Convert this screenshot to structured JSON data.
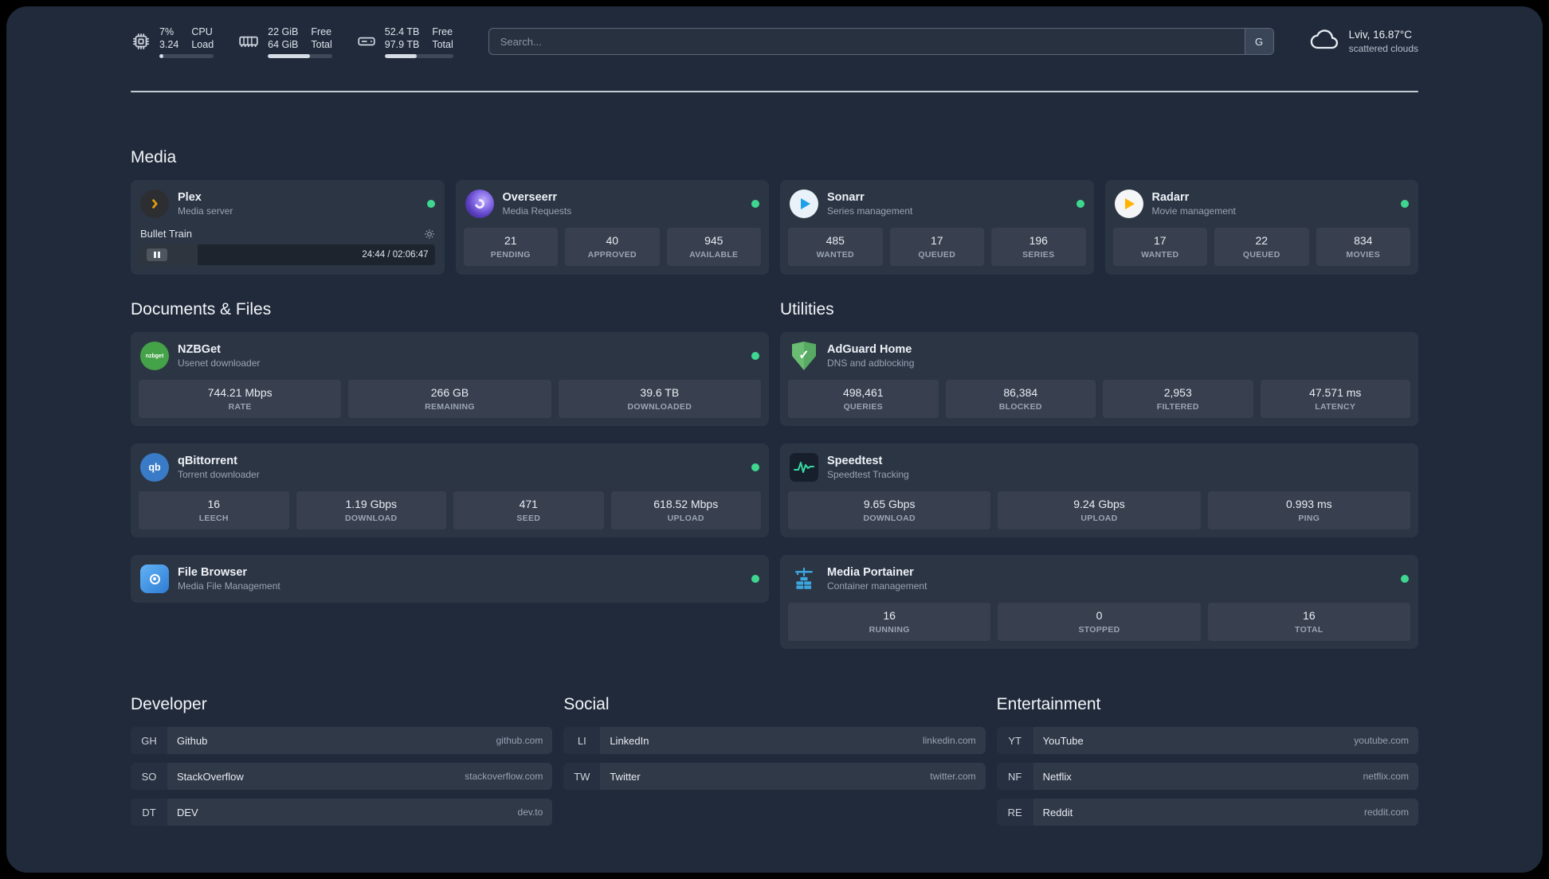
{
  "topbar": {
    "resources": [
      {
        "value_top": "7%",
        "value_bottom": "3.24",
        "label_top": "CPU",
        "label_bottom": "Load",
        "progress_pct": 7
      },
      {
        "value_top": "22 GiB",
        "value_bottom": "64 GiB",
        "label_top": "Free",
        "label_bottom": "Total",
        "progress_pct": 66
      },
      {
        "value_top": "52.4 TB",
        "value_bottom": "97.9 TB",
        "label_top": "Free",
        "label_bottom": "Total",
        "progress_pct": 47
      }
    ],
    "search": {
      "placeholder": "Search...",
      "provider_label": "G"
    },
    "weather": {
      "location": "Lviv, 16.87°C",
      "condition": "scattered clouds"
    }
  },
  "sections": {
    "media": {
      "title": "Media",
      "services": [
        {
          "name": "Plex",
          "subtitle": "Media server",
          "status": "online",
          "player": {
            "title": "Bullet Train",
            "time": "24:44 / 02:06:47",
            "progress_pct": 19.5
          }
        },
        {
          "name": "Overseerr",
          "subtitle": "Media Requests",
          "status": "online",
          "stats": [
            {
              "value": "21",
              "label": "PENDING"
            },
            {
              "value": "40",
              "label": "APPROVED"
            },
            {
              "value": "945",
              "label": "AVAILABLE"
            }
          ]
        },
        {
          "name": "Sonarr",
          "subtitle": "Series management",
          "status": "online",
          "stats": [
            {
              "value": "485",
              "label": "WANTED"
            },
            {
              "value": "17",
              "label": "QUEUED"
            },
            {
              "value": "196",
              "label": "SERIES"
            }
          ]
        },
        {
          "name": "Radarr",
          "subtitle": "Movie management",
          "status": "online",
          "stats": [
            {
              "value": "17",
              "label": "WANTED"
            },
            {
              "value": "22",
              "label": "QUEUED"
            },
            {
              "value": "834",
              "label": "MOVIES"
            }
          ]
        }
      ]
    },
    "documents": {
      "title": "Documents & Files",
      "services": [
        {
          "name": "NZBGet",
          "subtitle": "Usenet downloader",
          "status": "online",
          "icon_text": "nzbget",
          "stats": [
            {
              "value": "744.21 Mbps",
              "label": "RATE"
            },
            {
              "value": "266 GB",
              "label": "REMAINING"
            },
            {
              "value": "39.6 TB",
              "label": "DOWNLOADED"
            }
          ]
        },
        {
          "name": "qBittorrent",
          "subtitle": "Torrent downloader",
          "status": "online",
          "icon_text": "qb",
          "stats": [
            {
              "value": "16",
              "label": "LEECH"
            },
            {
              "value": "1.19 Gbps",
              "label": "DOWNLOAD"
            },
            {
              "value": "471",
              "label": "SEED"
            },
            {
              "value": "618.52 Mbps",
              "label": "UPLOAD"
            }
          ]
        },
        {
          "name": "File Browser",
          "subtitle": "Media File Management",
          "status": "online",
          "stats": []
        }
      ]
    },
    "utilities": {
      "title": "Utilities",
      "services": [
        {
          "name": "AdGuard Home",
          "subtitle": "DNS and adblocking",
          "stats": [
            {
              "value": "498,461",
              "label": "QUERIES"
            },
            {
              "value": "86,384",
              "label": "BLOCKED"
            },
            {
              "value": "2,953",
              "label": "FILTERED"
            },
            {
              "value": "47.571 ms",
              "label": "LATENCY"
            }
          ]
        },
        {
          "name": "Speedtest",
          "subtitle": "Speedtest Tracking",
          "stats": [
            {
              "value": "9.65 Gbps",
              "label": "DOWNLOAD"
            },
            {
              "value": "9.24 Gbps",
              "label": "UPLOAD"
            },
            {
              "value": "0.993 ms",
              "label": "PING"
            }
          ]
        },
        {
          "name": "Media Portainer",
          "subtitle": "Container management",
          "status": "online",
          "stats": [
            {
              "value": "16",
              "label": "RUNNING"
            },
            {
              "value": "0",
              "label": "STOPPED"
            },
            {
              "value": "16",
              "label": "TOTAL"
            }
          ]
        }
      ]
    }
  },
  "bookmarks": [
    {
      "title": "Developer",
      "links": [
        {
          "abbr": "GH",
          "name": "Github",
          "url": "github.com"
        },
        {
          "abbr": "SO",
          "name": "StackOverflow",
          "url": "stackoverflow.com"
        },
        {
          "abbr": "DT",
          "name": "DEV",
          "url": "dev.to"
        }
      ]
    },
    {
      "title": "Social",
      "links": [
        {
          "abbr": "LI",
          "name": "LinkedIn",
          "url": "linkedin.com"
        },
        {
          "abbr": "TW",
          "name": "Twitter",
          "url": "twitter.com"
        }
      ]
    },
    {
      "title": "Entertainment",
      "links": [
        {
          "abbr": "YT",
          "name": "YouTube",
          "url": "youtube.com"
        },
        {
          "abbr": "NF",
          "name": "Netflix",
          "url": "netflix.com"
        },
        {
          "abbr": "RE",
          "name": "Reddit",
          "url": "reddit.com"
        }
      ]
    }
  ],
  "colors": {
    "status_online": "#3fd68f",
    "plex_accent": "#e5a00d"
  }
}
